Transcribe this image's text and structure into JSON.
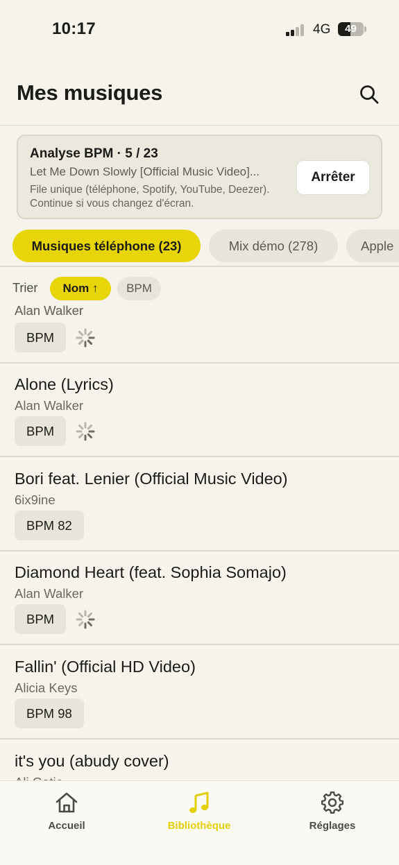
{
  "status_bar": {
    "time": "10:17",
    "network": "4G",
    "battery_percent": "49",
    "battery_level": 0.49,
    "signal_bars_active": 2,
    "signal_bars_total": 4
  },
  "header": {
    "title": "Mes musiques",
    "search_icon": "search-icon"
  },
  "analysis": {
    "title": "Analyse BPM · 5 / 23",
    "current_track": "Let Me Down Slowly [Official Music Video]...",
    "note": "File unique (téléphone, Spotify, YouTube, Deezer). Continue si vous changez d'écran.",
    "stop_label": "Arrêter"
  },
  "source_tabs": [
    {
      "label": "Musiques téléphone (23)",
      "active": true
    },
    {
      "label": "Mix démo (278)",
      "active": false
    },
    {
      "label": "Apple",
      "active": false
    }
  ],
  "sort": {
    "label": "Trier",
    "options": [
      {
        "label": "Nom ↑",
        "active": true
      },
      {
        "label": "BPM",
        "active": false
      }
    ]
  },
  "tracks": [
    {
      "title": "",
      "artist": "Alan Walker",
      "bpm_label": "BPM",
      "analyzing": true
    },
    {
      "title": "Alone (Lyrics)",
      "artist": "Alan Walker",
      "bpm_label": "BPM",
      "analyzing": true
    },
    {
      "title": "Bori feat. Lenier (Official Music Video)",
      "artist": "6ix9ine",
      "bpm_label": "BPM 82",
      "analyzing": false
    },
    {
      "title": "Diamond Heart (feat. Sophia Somajo)",
      "artist": "Alan Walker",
      "bpm_label": "BPM",
      "analyzing": true
    },
    {
      "title": "Fallin' (Official HD Video)",
      "artist": "Alicia Keys",
      "bpm_label": "BPM 98",
      "analyzing": false
    },
    {
      "title": "it's you (abudy cover)",
      "artist": "Ali Gatie",
      "bpm_label": "",
      "analyzing": false
    }
  ],
  "tab_bar": {
    "items": [
      {
        "label": "Accueil",
        "icon": "home-icon",
        "active": false
      },
      {
        "label": "Bibliothèque",
        "icon": "music-note-icon",
        "active": true
      },
      {
        "label": "Réglages",
        "icon": "gear-icon",
        "active": false
      }
    ]
  },
  "colors": {
    "accent": "#e8d507",
    "background": "#f5f3ec",
    "chip": "#e7e4da"
  }
}
